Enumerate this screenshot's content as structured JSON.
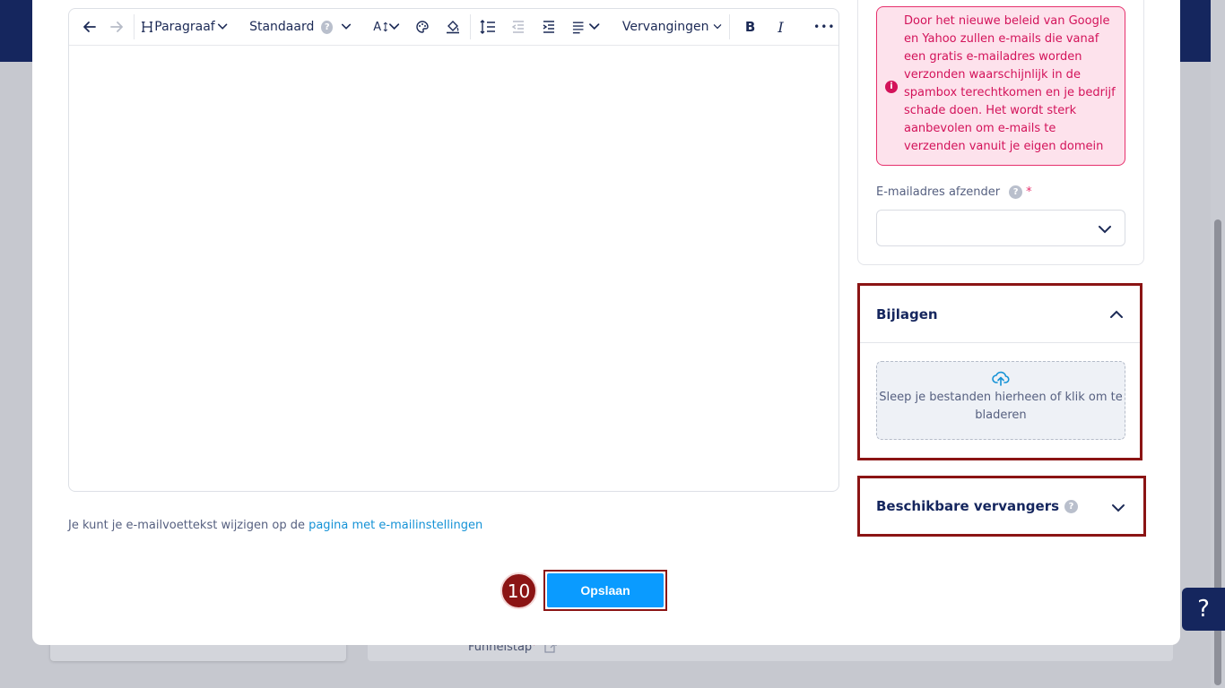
{
  "background": {
    "funnel_label": "Funnelstap",
    "funnel_required": "*"
  },
  "help": {
    "label": "?"
  },
  "toolbar": {
    "heading_label": "Paragraaf",
    "font_label": "Standaard",
    "font_help": "?",
    "font_size_label": "A",
    "replacements_label": "Vervangingen",
    "bold_label": "B",
    "italic_label": "I",
    "more_label": "•••"
  },
  "footer": {
    "text": "Je kunt je e-mailvoettekst wijzigen op de ",
    "link": "pagina met e-mailinstellingen"
  },
  "save": {
    "step": "10",
    "label": "Opslaan"
  },
  "sender": {
    "warning_icon": "i",
    "warning": "Door het nieuwe beleid van Google en Yahoo zullen e-mails die vanaf een gratis e-mailadres worden verzonden waarschijnlijk in de spambox terechtkomen en je bedrijf schade doen. Het wordt sterk aanbevolen om e-mails te verzenden vanuit je eigen domein",
    "field_label": "E-mailadres afzender",
    "field_help": "?",
    "required": "*",
    "value": ""
  },
  "attachments": {
    "title": "Bijlagen",
    "dropzone": "Sleep je bestanden hierheen of klik om te bladeren"
  },
  "replacements": {
    "title": "Beschikbare vervangers",
    "help": "?"
  }
}
